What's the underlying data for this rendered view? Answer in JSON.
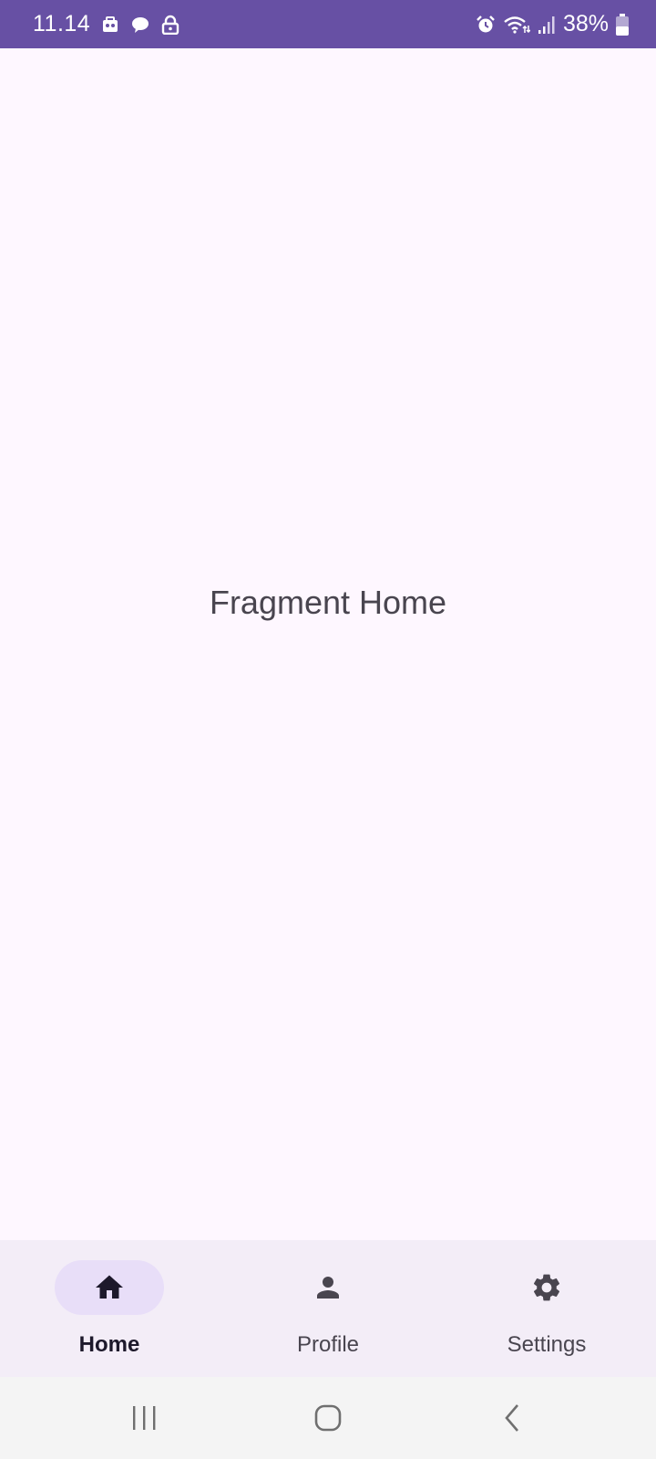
{
  "status_bar": {
    "time": "11.14",
    "battery_percent": "38%",
    "icons_left": [
      "app-notification-icon",
      "chat-bubble-icon",
      "lock-icon"
    ],
    "icons_right": [
      "alarm-icon",
      "wifi-icon",
      "signal-icon",
      "battery-icon"
    ],
    "background_color": "#6750A4"
  },
  "main": {
    "label": "Fragment Home"
  },
  "bottom_nav": {
    "items": [
      {
        "label": "Home",
        "icon": "home-icon",
        "active": true
      },
      {
        "label": "Profile",
        "icon": "person-icon",
        "active": false
      },
      {
        "label": "Settings",
        "icon": "gear-icon",
        "active": false
      }
    ],
    "active_indicator_color": "#E8DEF8"
  },
  "system_nav": {
    "buttons": [
      "recent-apps-icon",
      "home-circle-icon",
      "back-icon"
    ]
  }
}
